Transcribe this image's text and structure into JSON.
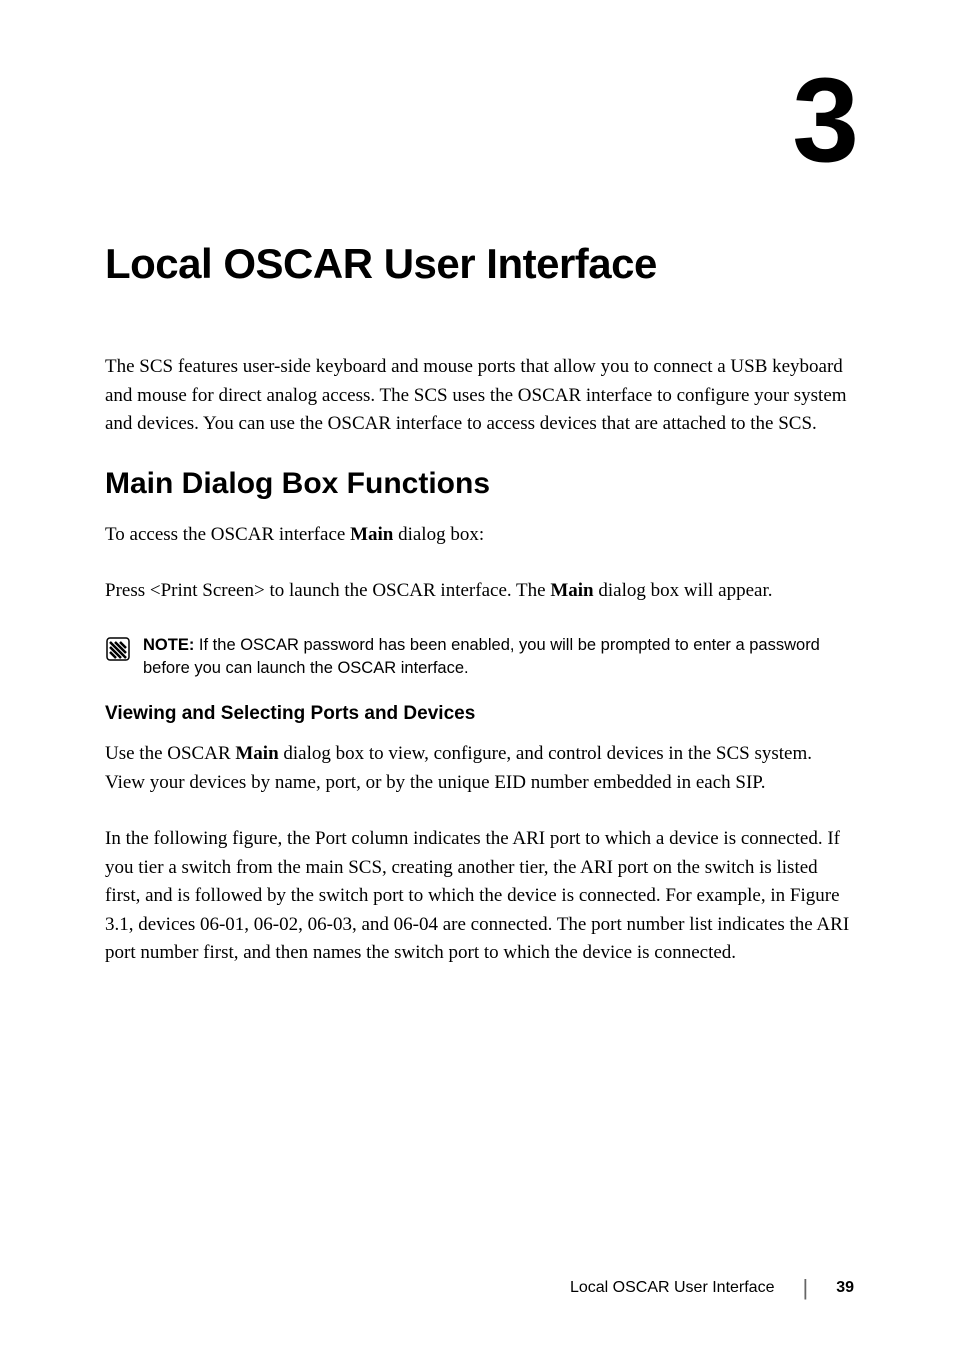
{
  "chapter": {
    "number": "3",
    "title": "Local OSCAR User Interface"
  },
  "intro_paragraph": "The SCS features user-side keyboard and mouse ports that allow you to connect a USB keyboard and mouse for direct analog access. The SCS uses the OSCAR interface to configure your system and devices. You can use the OSCAR interface to access devices that are attached to the SCS.",
  "section1": {
    "heading": "Main Dialog Box Functions",
    "para1_before": "To access the OSCAR interface ",
    "para1_bold": "Main",
    "para1_after": " dialog box:",
    "para2_before": "Press <Print Screen> to launch the OSCAR interface. The ",
    "para2_bold": "Main",
    "para2_after": " dialog box will appear."
  },
  "note": {
    "label": "NOTE:",
    "text": " If the OSCAR password has been enabled, you will be prompted to enter a password before you can launch the OSCAR interface."
  },
  "subsection": {
    "heading": "Viewing and Selecting Ports and Devices",
    "para1_before": "Use the OSCAR ",
    "para1_bold": "Main",
    "para1_after": " dialog box to view, configure, and control devices in the SCS system. View your devices by name, port, or by the unique EID number embedded in each SIP.",
    "para2": "In the following figure, the Port column indicates the ARI port to which a device is connected. If you tier a switch from the main SCS, creating another tier, the ARI port on the switch is listed first, and is followed by the switch port to which the device is connected. For example, in Figure 3.1, devices 06-01, 06-02, 06-03, and 06-04 are connected. The port number list indicates the ARI port number first, and then names the switch port to which the device is connected."
  },
  "footer": {
    "title": "Local OSCAR User Interface",
    "divider": "|",
    "page": "39"
  }
}
